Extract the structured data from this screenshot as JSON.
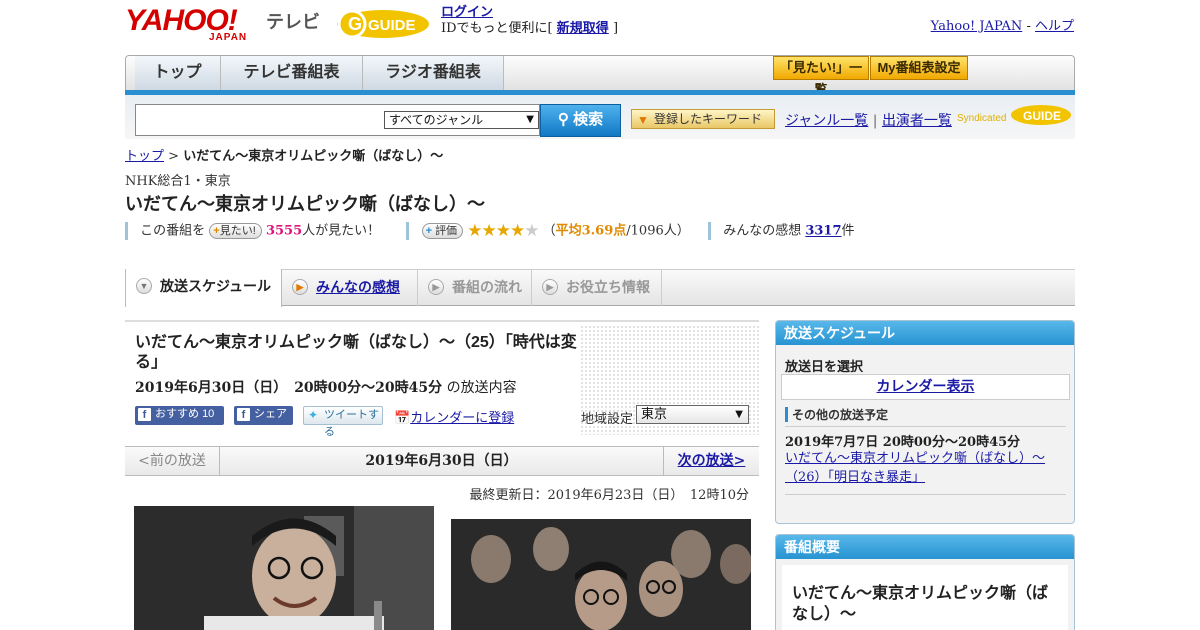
{
  "header": {
    "logo_text": "YAHOO!",
    "logo_sub": "JAPAN",
    "service_name": "テレビ",
    "gguide_text": "GUIDE",
    "login_label": "ログイン",
    "id_text": "IDでもっと便利に[",
    "signup_label": "新規取得",
    "id_text_end": "]",
    "yahoo_japan_link": "Yahoo! JAPAN",
    "separator": "-",
    "help_link": "ヘルプ"
  },
  "nav": {
    "tabs": [
      {
        "label": "トップ"
      },
      {
        "label": "テレビ番組表"
      },
      {
        "label": "ラジオ番組表"
      }
    ],
    "want_list_label": "「見たい!」一覧",
    "my_schedule_label": "My番組表設定"
  },
  "search": {
    "placeholder": "",
    "genre_selected": "すべてのジャンル",
    "button_label": "検索",
    "keyword_button_label": "登録したキーワード",
    "genre_list_link": "ジャンル一覧",
    "links_separator": "|",
    "performer_list_link": "出演者一覧",
    "syndicated_label": "Syndicated"
  },
  "breadcrumb": {
    "top_link": "トップ",
    "separator": ">",
    "current": "いだてん～東京オリムピック噺（ばなし）～"
  },
  "program": {
    "channel": "NHK総合1・東京",
    "title": "いだてん～東京オリムピック噺（ばなし）～",
    "want_prefix": "この番組を",
    "want_button": "見たい!",
    "want_count": "3555",
    "want_suffix": "人が見たい！",
    "rate_button": "評価",
    "rating_stars": 3.5,
    "avg_text": "平均3.69点",
    "rating_count": "/1096人",
    "rating_open": "（",
    "rating_close": "）",
    "review_prefix": "みんなの感想",
    "review_count": "3317",
    "review_suffix": "件"
  },
  "tabs": [
    {
      "label": "放送スケジュール",
      "active": true
    },
    {
      "label": "みんなの感想",
      "link": true
    },
    {
      "label": "番組の流れ"
    },
    {
      "label": "お役立ち情報"
    }
  ],
  "episode": {
    "title": "いだてん～東京オリムピック噺（ばなし）～（25）「時代は変る」",
    "datetime": "2019年6月30日（日）　20時00分～20時45分",
    "datetime_suffix": "の放送内容",
    "fb_recommend": "おすすめ",
    "fb_recommend_count": "10",
    "fb_share": "シェア",
    "tweet": "ツイートする",
    "calendar_register": "カレンダーに登録",
    "region_label": "地域設定",
    "region_selected": "東京",
    "prev_label": "<前の放送",
    "pager_date": "2019年6月30日（日）",
    "next_label": "次の放送>",
    "updated": "最終更新日：2019年6月23日（日）　12時10分"
  },
  "sidebar": {
    "schedule_title": "放送スケジュール",
    "select_date": "放送日を選択",
    "calendar_button": "カレンダー表示",
    "other_schedule": "その他の放送予定",
    "other_date": "2019年7月7日  20時00分～20時45分",
    "other_link": "いだてん～東京オリムピック噺（ばなし）～（26）「明日なき暴走」",
    "summary_title": "番組概要",
    "summary_program": "いだてん～東京オリムピック噺（ばなし）～"
  },
  "colors": {
    "accent_blue": "#2a8fd0",
    "yahoo_red": "#d40000",
    "link": "#1a1aa6",
    "star": "#e6a800"
  }
}
